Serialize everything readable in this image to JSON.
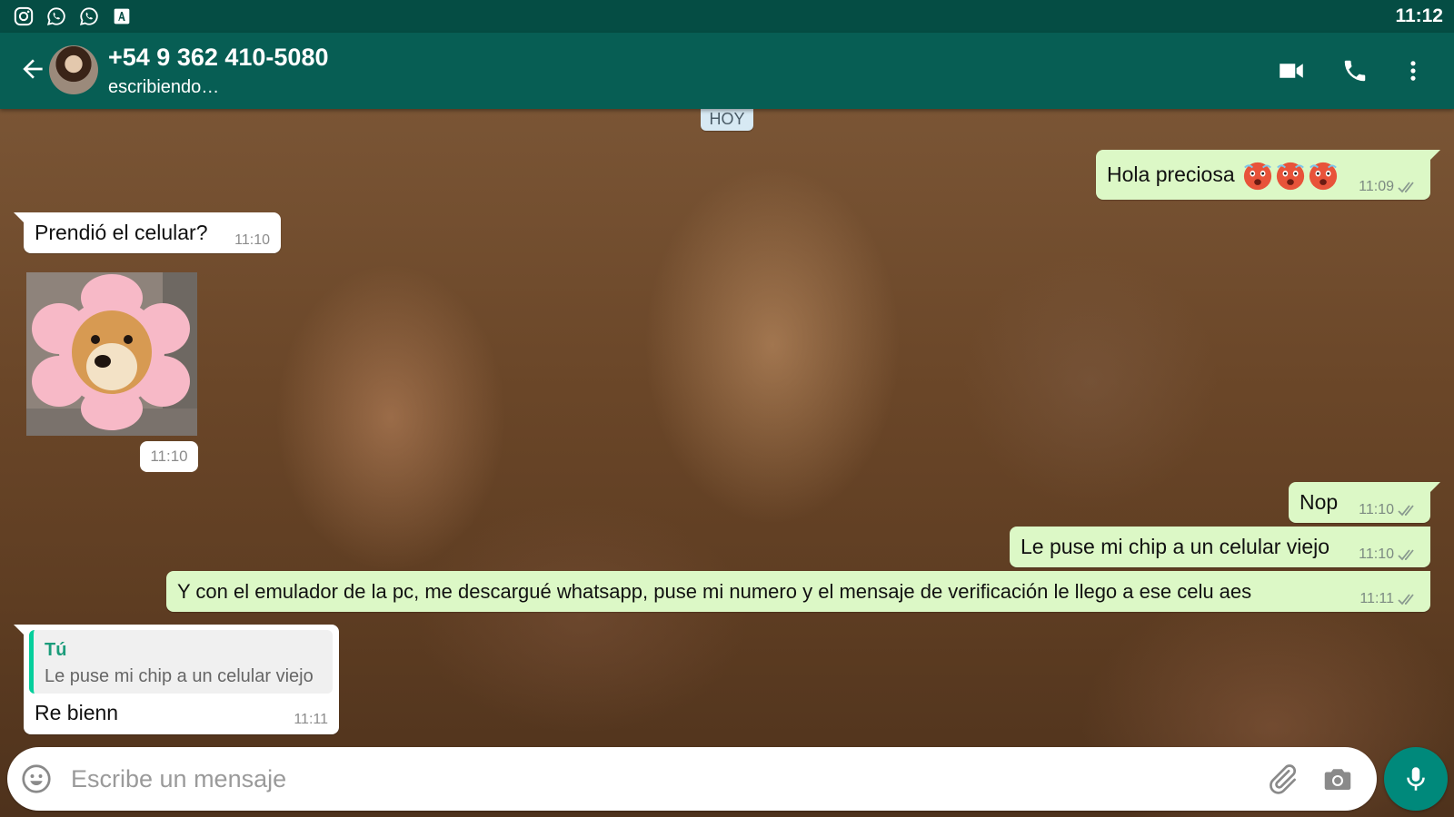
{
  "status_bar": {
    "time": "11:12",
    "icons": [
      "instagram-icon",
      "whatsapp-icon",
      "whatsapp-icon",
      "font-icon"
    ]
  },
  "header": {
    "contact_name": "+54 9 362 410-5080",
    "contact_status": "escribiendo…",
    "actions": [
      "video-call-icon",
      "phone-icon",
      "more-options-icon"
    ]
  },
  "chat": {
    "date_chip": "HOY",
    "messages": [
      {
        "direction": "out",
        "text": "Hola preciosa",
        "emoji": [
          "hot-face-emoji",
          "hot-face-emoji",
          "hot-face-emoji"
        ],
        "time": "11:09",
        "status": "read"
      },
      {
        "direction": "in",
        "text": "Prendió el celular?",
        "time": "11:10"
      },
      {
        "direction": "in",
        "type": "sticker",
        "sticker": "shiba-flower-sticker",
        "time": "11:10"
      },
      {
        "direction": "out",
        "text": "Nop",
        "time": "11:10",
        "status": "read"
      },
      {
        "direction": "out",
        "text": "Le puse mi chip a un celular viejo",
        "time": "11:10",
        "status": "read"
      },
      {
        "direction": "out",
        "text": "Y con el emulador de la pc, me descargué whatsapp, puse mi numero y el mensaje de verificación le llego a ese celu aes",
        "time": "11:11",
        "status": "read"
      },
      {
        "direction": "in",
        "reply_to": {
          "author": "Tú",
          "text": "Le puse mi chip a un celular viejo"
        },
        "text": "Re bienn",
        "time": "11:11"
      }
    ]
  },
  "composer": {
    "placeholder": "Escribe un mensaje",
    "value": ""
  },
  "colors": {
    "status_bar": "#054d44",
    "header": "#075e54",
    "outgoing_bubble": "#dcf8c6",
    "incoming_bubble": "#ffffff",
    "accent": "#00897b",
    "reply_accent": "#06cf9c",
    "read_ticks": "#8a9a90"
  }
}
